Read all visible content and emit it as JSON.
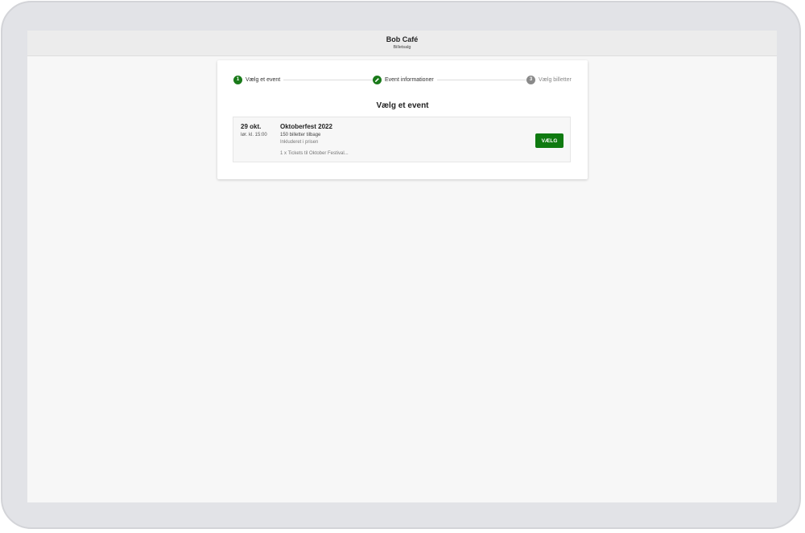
{
  "header": {
    "title": "Bob Café",
    "subtitle": "Billetsalg"
  },
  "stepper": {
    "steps": [
      {
        "number": "1",
        "label": "Vælg et event",
        "state": "active"
      },
      {
        "number": "",
        "label": "Event informationer",
        "state": "edit",
        "icon": "pencil-icon"
      },
      {
        "number": "3",
        "label": "Vælg billetter",
        "state": "pending"
      }
    ]
  },
  "main": {
    "section_title": "Vælg et event",
    "events": [
      {
        "date": "29 okt.",
        "time": "lør. kl. 15:00",
        "name": "Oktoberfest 2022",
        "remaining": "150 billetter tilbage",
        "included": "Inkluderet i prisen",
        "tickets": "1 x Tickets til Oktober Festival...",
        "button_label": "VÆLG"
      }
    ]
  },
  "colors": {
    "accent": "#0f7a10",
    "pending": "#8a8a8a",
    "frame": "#e2e3e7",
    "background": "#f7f7f7"
  }
}
